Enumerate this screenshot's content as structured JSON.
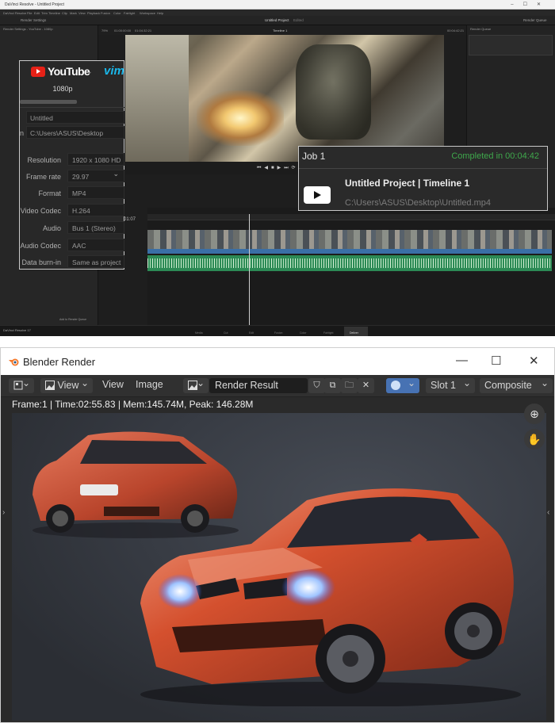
{
  "davinci": {
    "titlebar": "DaVinci Resolve - Untitled Project",
    "menu": [
      "DaVinci Resolve",
      "File",
      "Edit",
      "Trim",
      "Timeline",
      "Clip",
      "Mark",
      "View",
      "Playback",
      "Fusion",
      "Color",
      "Fairlight",
      "Workspace",
      "Help"
    ],
    "toolbar": {
      "render_settings": "Render Settings",
      "project_title": "Untitled Project",
      "edited": "Edited",
      "render_queue": "Render Queue"
    },
    "viewer": {
      "zoom": "79%",
      "tc_left": "01:00:00:00",
      "tc_right": "01:04:32:21",
      "timeline": "Timeline 1",
      "duration": "00:04:42:21"
    },
    "render_settings": {
      "header": "Render Settings - YouTube - 1080p",
      "preset_brand": "YouTube",
      "preset_alt": "vim",
      "resolution_label": "1080p",
      "name": "Untitled",
      "location": "C:\\Users\\ASUS\\Desktop",
      "location_prefix": "n",
      "rows": [
        {
          "label": "Resolution",
          "value": "1920 x 1080 HD"
        },
        {
          "label": "Frame rate",
          "value": "29.97"
        },
        {
          "label": "Format",
          "value": "MP4"
        },
        {
          "label": "Video Codec",
          "value": "H.264"
        },
        {
          "label": "Audio",
          "value": "Bus 1 (Stereo)"
        },
        {
          "label": "Audio Codec",
          "value": "AAC"
        },
        {
          "label": "Data burn-in",
          "value": "Same as project"
        }
      ]
    },
    "job": {
      "title": "Job 1",
      "status": "Completed in 00:04:42",
      "name": "Untitled Project | Timeline 1",
      "path": "C:\\Users\\ASUS\\Desktop\\Untitled.mp4"
    },
    "queue_header": "Render Queue",
    "timeline_tc": "01:07",
    "add_to_queue": "Add to Render Queue",
    "version": "DaVinci Resolve 17",
    "pages": [
      "Media",
      "Cut",
      "Edit",
      "Fusion",
      "Color",
      "Fairlight",
      "Deliver"
    ],
    "colors": {
      "status_green": "#3fa84c",
      "video_track": "#3a6fa6",
      "audio_track": "#2c8a55"
    }
  },
  "blender": {
    "window_title": "Blender Render",
    "window_controls": [
      "—",
      "☐",
      "✕"
    ],
    "menu": {
      "view": "View",
      "view2": "View",
      "image": "Image"
    },
    "image_name": "Render Result",
    "slot": "Slot 1",
    "layer": "Composite",
    "info": "Frame:1 | Time:02:55.83 | Mem:145.74M, Peak: 146.28M",
    "icons": [
      "editor-type-icon",
      "image-icon",
      "shield-icon",
      "copy-icon",
      "folder-icon",
      "close-icon",
      "render-pass-icon",
      "zoom-in-icon",
      "hand-icon"
    ],
    "colors": {
      "car": "#d4502e",
      "background": "#3a3e46"
    }
  }
}
